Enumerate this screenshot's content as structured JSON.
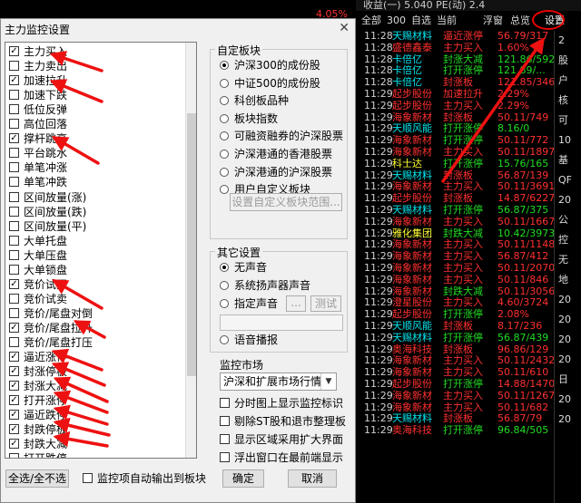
{
  "market": {
    "top_line": "收益(一)   5.040  PE(动)   2.4",
    "top_pct": "4.05%",
    "tabs": [
      "全部",
      "300",
      "自选",
      "当前",
      "浮窗",
      "总览"
    ],
    "settings_label": "设置",
    "side_labels": [
      "2",
      "股",
      "户",
      "核",
      "可",
      "10",
      "基",
      "QF",
      "20",
      "公",
      "控",
      "无",
      "地",
      "20",
      "20",
      "20",
      "20",
      "日",
      "20",
      "20"
    ],
    "colors": {
      "white": "#e8e8e8",
      "yellow": "#ffff33",
      "cyan": "#00e5ee",
      "red": "#ff3030",
      "green": "#22dd22",
      "brand_red": "#e00000"
    },
    "rows": [
      {
        "time": "11:28",
        "name": "天赐材料",
        "event": "逼近涨停",
        "value": "56.79/317",
        "nc": "cyan",
        "ec": "red",
        "vc": "red"
      },
      {
        "time": "11:28",
        "name": "盛德鑫泰",
        "event": "主力买入",
        "value": "1.60%",
        "nc": "red",
        "ec": "red",
        "vc": "red"
      },
      {
        "time": "11:28",
        "name": "卡倍亿",
        "event": "封涨大减",
        "value": "121.86/592",
        "nc": "cyan",
        "ec": "green",
        "vc": "green"
      },
      {
        "time": "11:28",
        "name": "卡倍亿",
        "event": "打开涨停",
        "value": "121.89/...",
        "nc": "cyan",
        "ec": "green",
        "vc": "green"
      },
      {
        "time": "11:28",
        "name": "卡倍亿",
        "event": "封涨板",
        "value": "121.85/346",
        "nc": "cyan",
        "ec": "red",
        "vc": "red"
      },
      {
        "time": "11:29",
        "name": "起步股份",
        "event": "加速拉升",
        "value": "2.29%",
        "nc": "red",
        "ec": "red",
        "vc": "red"
      },
      {
        "time": "11:29",
        "name": "起步股份",
        "event": "主力买入",
        "value": "2.29%",
        "nc": "red",
        "ec": "red",
        "vc": "red"
      },
      {
        "time": "11:29",
        "name": "海象新材",
        "event": "封涨板",
        "value": "50.11/749",
        "nc": "red",
        "ec": "red",
        "vc": "red"
      },
      {
        "time": "11:29",
        "name": "天顺风能",
        "event": "打开涨停",
        "value": "8.16/0",
        "nc": "cyan",
        "ec": "green",
        "vc": "green"
      },
      {
        "time": "11:29",
        "name": "海象新材",
        "event": "打开涨停",
        "value": "50.11/772",
        "nc": "red",
        "ec": "green",
        "vc": "red"
      },
      {
        "time": "11:29",
        "name": "海象新材",
        "event": "主力买入",
        "value": "50.11/1897",
        "nc": "red",
        "ec": "red",
        "vc": "red"
      },
      {
        "time": "11:29",
        "name": "科士达",
        "event": "打开涨停",
        "value": "15.76/165",
        "nc": "yellow",
        "ec": "green",
        "vc": "green"
      },
      {
        "time": "11:29",
        "name": "天赐材料",
        "event": "封涨板",
        "value": "56.87/139",
        "nc": "cyan",
        "ec": "red",
        "vc": "red"
      },
      {
        "time": "11:29",
        "name": "海象新材",
        "event": "主力买入",
        "value": "50.11/3691",
        "nc": "red",
        "ec": "red",
        "vc": "red"
      },
      {
        "time": "11:29",
        "name": "起步股份",
        "event": "封涨板",
        "value": "14.87/6227",
        "nc": "red",
        "ec": "red",
        "vc": "red"
      },
      {
        "time": "11:29",
        "name": "天赐材料",
        "event": "打开涨停",
        "value": "56.87/375",
        "nc": "cyan",
        "ec": "green",
        "vc": "green"
      },
      {
        "time": "11:29",
        "name": "海象新材",
        "event": "主力买入",
        "value": "50.11/1667",
        "nc": "red",
        "ec": "red",
        "vc": "red"
      },
      {
        "time": "11:29",
        "name": "雅化集团",
        "event": "封跌大减",
        "value": "10.42/39733",
        "nc": "yellow",
        "ec": "green",
        "vc": "green"
      },
      {
        "time": "11:29",
        "name": "海象新材",
        "event": "主力买入",
        "value": "50.11/1148",
        "nc": "red",
        "ec": "red",
        "vc": "red"
      },
      {
        "time": "11:29",
        "name": "海象新材",
        "event": "主力买入",
        "value": "56.87/412",
        "nc": "red",
        "ec": "red",
        "vc": "red"
      },
      {
        "time": "11:29",
        "name": "海象新材",
        "event": "主力买入",
        "value": "50.11/2070",
        "nc": "red",
        "ec": "red",
        "vc": "red"
      },
      {
        "time": "11:29",
        "name": "海象新材",
        "event": "主力买入",
        "value": "50.11/846",
        "nc": "red",
        "ec": "red",
        "vc": "red"
      },
      {
        "time": "11:29",
        "name": "海象新材",
        "event": "封跌大减",
        "value": "50.11/3056",
        "nc": "red",
        "ec": "green",
        "vc": "red"
      },
      {
        "time": "11:29",
        "name": "澄星股份",
        "event": "主力买入",
        "value": "4.60/3724",
        "nc": "red",
        "ec": "red",
        "vc": "red"
      },
      {
        "time": "11:29",
        "name": "起步股份",
        "event": "打开涨停",
        "value": "2.08%",
        "nc": "red",
        "ec": "green",
        "vc": "red"
      },
      {
        "time": "11:29",
        "name": "天顺风能",
        "event": "封涨板",
        "value": "8.17/236",
        "nc": "cyan",
        "ec": "red",
        "vc": "red"
      },
      {
        "time": "11:29",
        "name": "天赐材料",
        "event": "打开涨停",
        "value": "56.87/439",
        "nc": "cyan",
        "ec": "green",
        "vc": "green"
      },
      {
        "time": "11:29",
        "name": "奥海科技",
        "event": "封涨板",
        "value": "96.86/129",
        "nc": "red",
        "ec": "red",
        "vc": "red"
      },
      {
        "time": "11:29",
        "name": "海象新材",
        "event": "主力买入",
        "value": "50.11/2432",
        "nc": "red",
        "ec": "red",
        "vc": "red"
      },
      {
        "time": "11:29",
        "name": "海象新材",
        "event": "主力买入",
        "value": "50.11/610",
        "nc": "red",
        "ec": "red",
        "vc": "red"
      },
      {
        "time": "11:29",
        "name": "起步股份",
        "event": "打开涨停",
        "value": "14.88/1470",
        "nc": "red",
        "ec": "green",
        "vc": "red"
      },
      {
        "time": "11:29",
        "name": "海象新材",
        "event": "主力买入",
        "value": "50.11/1267",
        "nc": "red",
        "ec": "red",
        "vc": "red"
      },
      {
        "time": "11:29",
        "name": "海象新材",
        "event": "主力买入",
        "value": "50.11/682",
        "nc": "red",
        "ec": "red",
        "vc": "red"
      },
      {
        "time": "11:29",
        "name": "天赐材料",
        "event": "封涨板",
        "value": "56.87/79",
        "nc": "cyan",
        "ec": "red",
        "vc": "red"
      },
      {
        "time": "11:29",
        "name": "奥海科技",
        "event": "打开涨停",
        "value": "96.84/505",
        "nc": "red",
        "ec": "green",
        "vc": "green"
      }
    ]
  },
  "dialog": {
    "title": "主力监控设置",
    "close_glyph": "✕",
    "list_items": [
      {
        "label": "主力买入",
        "checked": true
      },
      {
        "label": "主力卖出",
        "checked": false
      },
      {
        "label": "加速拉升",
        "checked": true
      },
      {
        "label": "加速下跌",
        "checked": false
      },
      {
        "label": "低位反弹",
        "checked": false
      },
      {
        "label": "高位回落",
        "checked": false
      },
      {
        "label": "撑杆跳高",
        "checked": true
      },
      {
        "label": "平台跳水",
        "checked": false
      },
      {
        "label": "单笔冲涨",
        "checked": false
      },
      {
        "label": "单笔冲跌",
        "checked": false
      },
      {
        "label": "区间放量(涨)",
        "checked": false
      },
      {
        "label": "区间放量(跌)",
        "checked": false
      },
      {
        "label": "区间放量(平)",
        "checked": false
      },
      {
        "label": "大单托盘",
        "checked": false
      },
      {
        "label": "大单压盘",
        "checked": false
      },
      {
        "label": "大单锁盘",
        "checked": false
      },
      {
        "label": "竞价试买",
        "checked": true
      },
      {
        "label": "竞价试卖",
        "checked": false
      },
      {
        "label": "竞价/尾盘对倒",
        "checked": false
      },
      {
        "label": "竞价/尾盘拉升",
        "checked": true
      },
      {
        "label": "竞价/尾盘打压",
        "checked": false
      },
      {
        "label": "逼近涨停",
        "checked": true
      },
      {
        "label": "封涨停板",
        "checked": true
      },
      {
        "label": "封涨大减",
        "checked": true
      },
      {
        "label": "打开涨停",
        "checked": true
      },
      {
        "label": "逼近跌停",
        "checked": true
      },
      {
        "label": "封跌停板",
        "checked": true
      },
      {
        "label": "封跌大减",
        "checked": true
      },
      {
        "label": "打开跌停",
        "checked": false
      }
    ],
    "custom_group_title": "自定板块",
    "custom_options": [
      "沪深300的成份股",
      "中证500的成份股",
      "科创板品种",
      "板块指数",
      "可融资融券的沪深股票",
      "沪深港通的香港股票",
      "沪深港通的沪深股票",
      "用户自定义板块"
    ],
    "custom_selected": 0,
    "custom_button": "设置自定义板块范围...",
    "other_group_title": "其它设置",
    "sound_options": [
      "无声音",
      "系统扬声器声音",
      "指定声音"
    ],
    "sound_selected": 0,
    "browse_button": "...",
    "test_button": "测试",
    "voice_option": "语音播报",
    "market_label": "监控市场",
    "market_value": "沪深和扩展市场行情",
    "checks": [
      "分时图上显示监控标识",
      "剔除ST股和退市整理板",
      "显示区域采用扩大界面",
      "浮出窗口在最前端显示"
    ],
    "select_all_button": "全选/全不选",
    "auto_output_label": "监控项自动输出到板块",
    "ok_button": "确定",
    "cancel_button": "取消"
  }
}
